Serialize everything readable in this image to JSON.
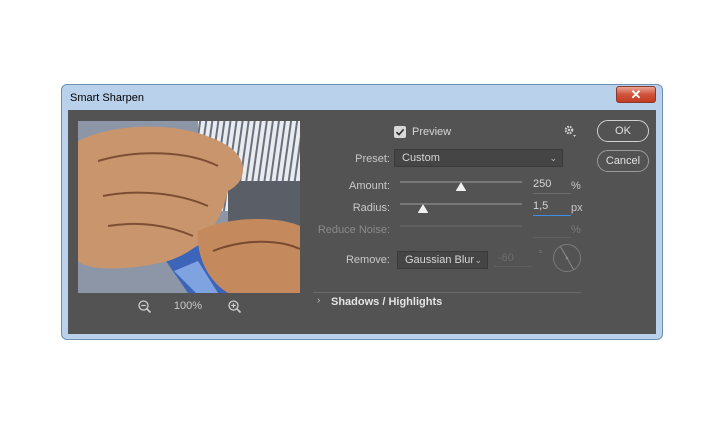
{
  "window": {
    "title": "Smart Sharpen",
    "close_icon": "close-icon"
  },
  "preview_panel": {
    "zoom_level": "100%",
    "zoom_out_icon": "zoom-out-icon",
    "zoom_in_icon": "zoom-in-icon"
  },
  "controls": {
    "preview_label": "Preview",
    "preview_checked": true,
    "preset_label": "Preset:",
    "preset_value": "Custom",
    "amount_label": "Amount:",
    "amount_value": "250",
    "amount_unit": "%",
    "amount_fraction": 0.5,
    "radius_label": "Radius:",
    "radius_value": "1,5",
    "radius_unit": "px",
    "radius_fraction": 0.19,
    "reduce_noise_label": "Reduce Noise:",
    "reduce_noise_unit": "%",
    "remove_label": "Remove:",
    "remove_value": "Gaussian Blur",
    "angle_value": "-60",
    "angle_unit": "°"
  },
  "buttons": {
    "ok": "OK",
    "cancel": "Cancel"
  },
  "section": {
    "shadows_highlights": "Shadows / Highlights"
  },
  "colors": {
    "dialog_bg": "#535353",
    "frame": "#b9d1ea",
    "accent": "#3e8ee5"
  }
}
